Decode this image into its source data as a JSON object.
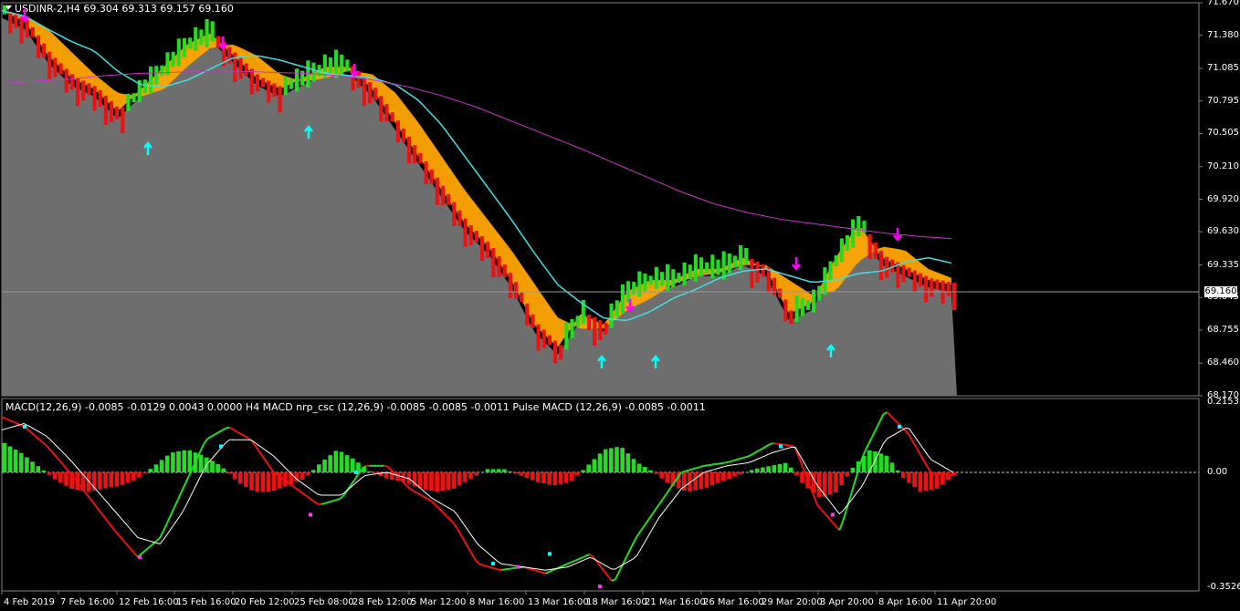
{
  "symbol_header": {
    "symbol": "USDINR-2,H4",
    "ohlc": "69.304 69.313 69.157 69.160"
  },
  "indicator_header": "MACD(12,26,9) -0.0085 -0.0129 0.0043 0.0000  H4 MACD nrp_csc (12,26,9) -0.0085 -0.0085 -0.0011  Pulse MACD (12,26,9) -0.0085 -0.0011",
  "colors": {
    "background": "#000000",
    "price_area": "#6e6e6e",
    "bull_bar": "#22dd22",
    "bear_bar": "#ee1111",
    "fast_ma_band": "#00ffff",
    "slow_ma_band": "#ffa500",
    "ma_mid": "#40e0e0",
    "ma_long": "#cc33cc",
    "arrow_up": "#00ffff",
    "arrow_down": "#ff00ff",
    "macd_pos": "#22dd22",
    "macd_neg": "#ee1111",
    "signal_line": "#ffffff"
  },
  "price_axis": [
    "71.670",
    "71.380",
    "71.085",
    "70.795",
    "70.505",
    "70.210",
    "69.920",
    "69.630",
    "69.335",
    "69.045",
    "68.755",
    "68.460",
    "68.170"
  ],
  "current_price": "69.160",
  "macd_axis": [
    "0.2153",
    "0.00",
    "-0.3526"
  ],
  "time_axis": [
    "4 Feb 2019",
    "7 Feb 16:00",
    "12 Feb 16:00",
    "15 Feb 16:00",
    "20 Feb 12:00",
    "25 Feb 08:00",
    "28 Feb 12:00",
    "5 Mar 12:00",
    "8 Mar 16:00",
    "13 Mar 16:00",
    "18 Mar 16:00",
    "21 Mar 16:00",
    "26 Mar 16:00",
    "29 Mar 20:00",
    "3 Apr 20:00",
    "8 Apr 16:00",
    "11 Apr 20:00"
  ],
  "chart_data": [
    {
      "type": "bar",
      "title": "USDINR-2,H4",
      "ylim": [
        68.17,
        71.67
      ],
      "close_series_approx": [
        71.6,
        71.5,
        71.2,
        71.0,
        70.9,
        70.7,
        70.9,
        71.1,
        71.3,
        71.4,
        71.2,
        71.0,
        70.9,
        71.0,
        71.1,
        71.1,
        70.9,
        70.6,
        70.3,
        70.0,
        69.7,
        69.5,
        69.2,
        68.8,
        68.6,
        68.9,
        68.8,
        69.1,
        69.2,
        69.2,
        69.3,
        69.3,
        69.4,
        69.3,
        68.9,
        69.0,
        69.4,
        69.7,
        69.4,
        69.3,
        69.2,
        69.16
      ],
      "ma_long_approx": [
        70.95,
        70.97,
        70.99,
        71.02,
        71.04,
        71.05,
        71.06,
        71.06,
        71.05,
        71.04,
        71.02,
        70.98,
        70.92,
        70.84,
        70.74,
        70.62,
        70.5,
        70.38,
        70.25,
        70.12,
        69.99,
        69.88,
        69.8,
        69.74,
        69.7,
        69.66,
        69.62,
        69.59,
        69.57
      ]
    },
    {
      "type": "bar",
      "title": "MACD(12,26,9)",
      "ylim": [
        -0.3526,
        0.2153
      ],
      "histogram_approx": [
        0.09,
        0.06,
        0.02,
        -0.02,
        -0.05,
        -0.06,
        -0.05,
        -0.04,
        -0.02,
        0.02,
        0.06,
        0.07,
        0.05,
        0.02,
        -0.03,
        -0.06,
        -0.06,
        -0.04,
        -0.02,
        0.03,
        0.07,
        0.04,
        0.0,
        -0.02,
        -0.03,
        -0.05,
        -0.06,
        -0.05,
        -0.02,
        0.01,
        0.01,
        -0.01,
        -0.03,
        -0.04,
        -0.03,
        0.02,
        0.07,
        0.08,
        0.03,
        0.0,
        -0.04,
        -0.06,
        -0.05,
        -0.03,
        -0.01,
        0.01,
        0.02,
        0.03,
        -0.04,
        -0.08,
        -0.06,
        0.02,
        0.07,
        0.05,
        -0.02,
        -0.06,
        -0.05,
        -0.01
      ],
      "macd_line_approx": [
        0.17,
        0.14,
        0.08,
        0.0,
        -0.09,
        -0.18,
        -0.26,
        -0.2,
        -0.05,
        0.1,
        0.14,
        0.1,
        0.0,
        -0.05,
        -0.1,
        -0.08,
        0.02,
        0.02,
        -0.05,
        -0.09,
        -0.16,
        -0.28,
        -0.3,
        -0.29,
        -0.31,
        -0.28,
        -0.25,
        -0.34,
        -0.2,
        -0.1,
        0.0,
        0.02,
        0.03,
        0.05,
        0.09,
        0.08,
        -0.1,
        -0.18,
        0.05,
        0.19,
        0.12,
        0.0,
        -0.01
      ],
      "signal_line_approx": [
        0.13,
        0.15,
        0.11,
        0.04,
        -0.04,
        -0.12,
        -0.2,
        -0.22,
        -0.12,
        0.02,
        0.1,
        0.1,
        0.05,
        -0.02,
        -0.07,
        -0.07,
        -0.01,
        0.0,
        -0.02,
        -0.08,
        -0.12,
        -0.22,
        -0.28,
        -0.29,
        -0.3,
        -0.29,
        -0.26,
        -0.3,
        -0.26,
        -0.14,
        -0.05,
        0.0,
        0.02,
        0.03,
        0.06,
        0.08,
        -0.04,
        -0.13,
        -0.04,
        0.1,
        0.14,
        0.04,
        0.0
      ]
    }
  ]
}
